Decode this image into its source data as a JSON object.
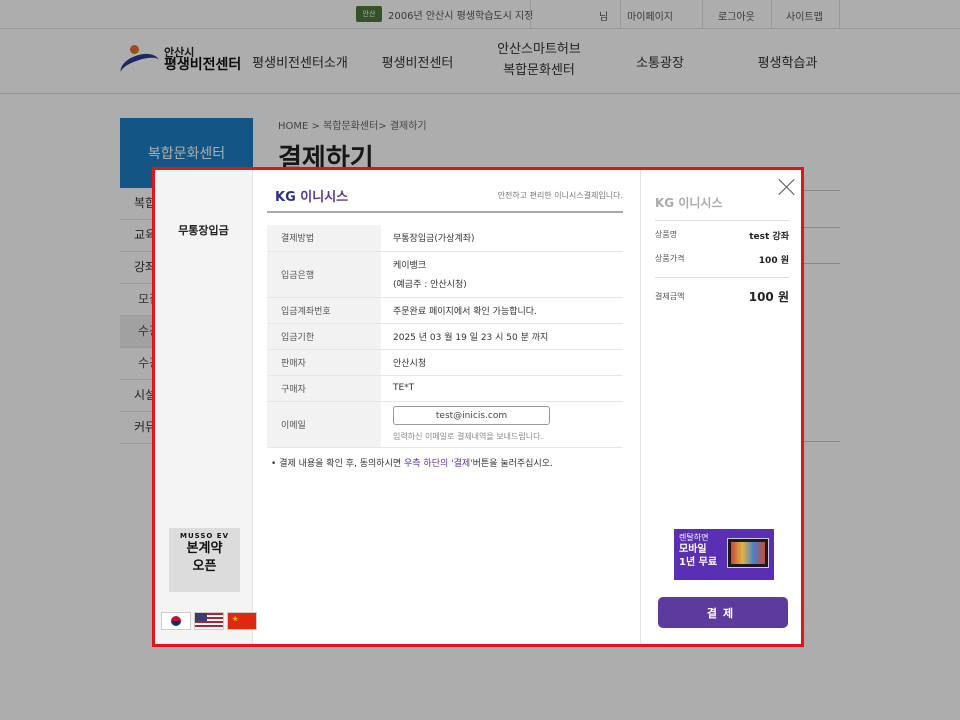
{
  "topbar": {
    "notice": "2006년 안산시 평생학습도시 지정",
    "notice_badge": "안산",
    "user": "님",
    "links": [
      "마이페이지",
      "로그아웃",
      "사이트맵"
    ]
  },
  "header": {
    "logo_line1": "안산시",
    "logo_line2": "평생비전센터",
    "nav": [
      "평생비전센터소개",
      "평생비전센터",
      "안산스마트허브\n복합문화센터",
      "소통광장",
      "평생학습과"
    ]
  },
  "background": {
    "breadcrumb": "HOME > 복합문화센터> 결제하기",
    "page_title": "결제하기",
    "lnb_title": "복합문화센터",
    "lnb_items": [
      "복합",
      "교육",
      "강좌",
      "모집",
      "수강",
      "수강",
      "시설",
      "커뮤"
    ]
  },
  "modal": {
    "left": {
      "method": "무통장입금",
      "ad_brand": "MUSSO EV",
      "ad_line1": "본계약",
      "ad_line2": "오픈",
      "flags": [
        "kr",
        "us",
        "cn"
      ]
    },
    "center": {
      "brand_kg": "KG",
      "brand_name": "이니시스",
      "tagline": "안전하고 편리한 이니시스결제입니다.",
      "rows": [
        {
          "label": "결제방법",
          "value": "무통장입금(가상계좌)"
        },
        {
          "label": "입금은행",
          "value": "케이뱅크",
          "value2": "(예금주 : 안산시청)"
        },
        {
          "label": "입금계좌번호",
          "value": "주문완료 페이지에서 확인 가능합니다."
        },
        {
          "label": "입금기한",
          "value": "2025 년 03 월 19 일 23 시 50 분 까지"
        },
        {
          "label": "판매자",
          "value": "안산시청"
        },
        {
          "label": "구매자",
          "value": "TE*T"
        }
      ],
      "email_label": "이메일",
      "email_value": "test@inicis.com",
      "email_hint": "입력하신 이메일로 결제내역을 보내드립니다.",
      "note_bullet": "•",
      "note_before": "결제 내용을 확인 후, 동의하시면 ",
      "note_highlight": "우측 하단의 '결제'",
      "note_after": "버튼을 눌러주십시오."
    },
    "right": {
      "brand": "KG 이니시스",
      "product_label": "상품명",
      "product_value": "test 강좌",
      "price_label": "상품가격",
      "price_value": "100 원",
      "total_label": "결제금액",
      "total_value": "100 원",
      "ad_line1": "렌탈하면",
      "ad_line2": "모바일",
      "ad_line3": "1년 무료",
      "pay_button": "결제"
    }
  }
}
